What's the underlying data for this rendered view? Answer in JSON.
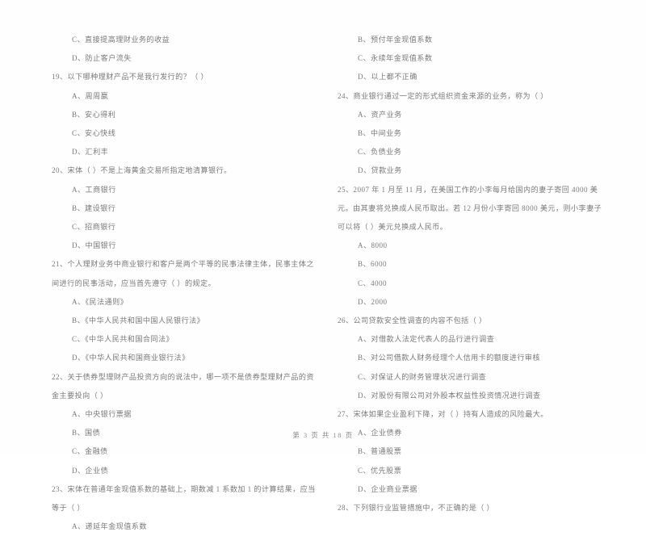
{
  "document": {
    "type": "scanned-exam-page",
    "language": "zh-CN",
    "footer": "第 3 页 共 18 页"
  },
  "columns": [
    {
      "side": "left",
      "blocks": [
        {
          "kind": "option",
          "text": "C、直接提高理财业务的收益"
        },
        {
          "kind": "option",
          "text": "D、防止客户流失"
        },
        {
          "kind": "stem",
          "text": "19、以下哪种理财产品不是我行发行的？（      ）"
        },
        {
          "kind": "option",
          "text": "A、周周嬴"
        },
        {
          "kind": "option",
          "text": "B、安心得利"
        },
        {
          "kind": "option",
          "text": "C、安心快线"
        },
        {
          "kind": "option",
          "text": "D、汇利丰"
        },
        {
          "kind": "stem",
          "text": "20、宋体（      ）不是上海黄金交易所指定地清算银行。"
        },
        {
          "kind": "option",
          "text": "A、工商银行"
        },
        {
          "kind": "option",
          "text": "B、建设银行"
        },
        {
          "kind": "option",
          "text": "C、招商银行"
        },
        {
          "kind": "option",
          "text": "D、中国银行"
        },
        {
          "kind": "stem",
          "text": "21、个人理财业务中商业银行和客户是两个平等的民事法律主体，民事主体之间进行的民事活动，应当首先遵守（      ）的规定。"
        },
        {
          "kind": "option",
          "text": "A、《民法通则》"
        },
        {
          "kind": "option",
          "text": "B、《中华人民共和国中国人民银行法》"
        },
        {
          "kind": "option",
          "text": "C、《中华人民共和国合同法》"
        },
        {
          "kind": "option",
          "text": "D、《中华人民共和国商业银行法》"
        },
        {
          "kind": "stem",
          "text": "22、关于债券型理财产品投资方向的说法中，哪一项不是债券型理财产品的资金主要投向（      ）"
        },
        {
          "kind": "option",
          "text": "A、中央银行票据"
        },
        {
          "kind": "option",
          "text": "B、国债"
        },
        {
          "kind": "option",
          "text": "C、金融债"
        },
        {
          "kind": "option",
          "text": "D、企业债"
        },
        {
          "kind": "stem",
          "text": "23、宋体在普通年金现值系数的基础上，期数减 1 系数加 1 的计算结果，应当等于（      ）"
        },
        {
          "kind": "option",
          "text": "A、递延年金现值系数"
        }
      ]
    },
    {
      "side": "right",
      "blocks": [
        {
          "kind": "option",
          "text": "B、预付年金现值系数"
        },
        {
          "kind": "option",
          "text": "C、永续年金现值系数"
        },
        {
          "kind": "option",
          "text": "D、以上都不正确"
        },
        {
          "kind": "stem",
          "text": "24、商业银行通过一定的形式组织资金来源的业务，称为（      ）"
        },
        {
          "kind": "option",
          "text": "A、资产业务"
        },
        {
          "kind": "option",
          "text": "B、中间业务"
        },
        {
          "kind": "option",
          "text": "C、负债业务"
        },
        {
          "kind": "option",
          "text": "D、贷款业务"
        },
        {
          "kind": "stem",
          "text": "25、2007 年 1 月至 11 月，在美国工作的小李每月给国内的妻子寄回 4000 美元。由其妻将兑换成人民币取出。若 12 月份小李寄回 8000 美元，则小李妻子可以将（      ）美元兑换成人民币。"
        },
        {
          "kind": "option",
          "text": "A、8000"
        },
        {
          "kind": "option",
          "text": "B、6000"
        },
        {
          "kind": "option",
          "text": "C、4000"
        },
        {
          "kind": "option",
          "text": "D、2000"
        },
        {
          "kind": "stem",
          "text": "26、公司贷款安全性调查的内容不包括（      ）"
        },
        {
          "kind": "option",
          "text": "A、对借款人法定代表人的品行进行调查"
        },
        {
          "kind": "option",
          "text": "B、对公司借款人财务经理个人信用卡的额度进行审核"
        },
        {
          "kind": "option",
          "text": "C、对保证人的财务管理状况进行调查"
        },
        {
          "kind": "option",
          "text": "D、对股份有限公司对外股本权益性投资情况进行调查"
        },
        {
          "kind": "stem",
          "text": "27、宋体如果企业盈利下降，对（      ）持有人造成的风险最大。"
        },
        {
          "kind": "option",
          "text": "A、企业债券"
        },
        {
          "kind": "option",
          "text": "B、普通股票"
        },
        {
          "kind": "option",
          "text": "C、优先股票"
        },
        {
          "kind": "option",
          "text": "D、企业商业票据"
        },
        {
          "kind": "stem",
          "text": "28、下列银行业监管措施中，不正确的是（      ）"
        }
      ]
    }
  ]
}
